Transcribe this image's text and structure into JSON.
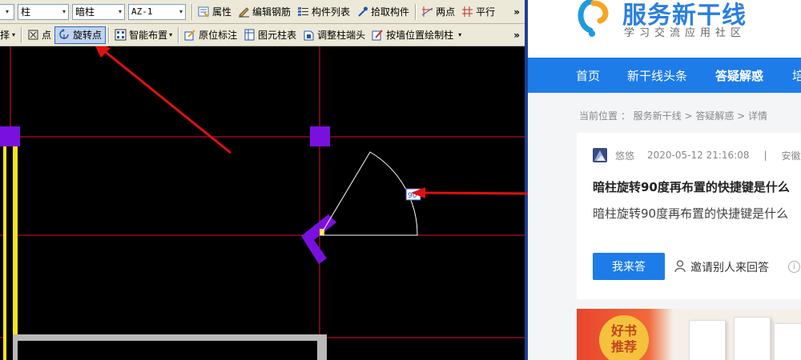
{
  "cad": {
    "toolbar1": {
      "combo_prefix_arrow": "▾",
      "combo_type": "柱",
      "combo_subtype": "暗柱",
      "combo_name": "AZ-1",
      "btn_properties": "属性",
      "btn_edit_rebar": "编辑钢筋",
      "btn_component_list": "构件列表",
      "btn_pick_component": "拾取构件",
      "btn_two_points": "两点",
      "btn_parallel": "平行",
      "more": "»"
    },
    "toolbar2": {
      "btn_select": "择",
      "btn_point": "点",
      "btn_rotate_point": "旋转点",
      "btn_smart_place": "智能布置",
      "btn_origin_mark": "原位标注",
      "btn_table_column": "图元柱表",
      "btn_adjust_column_end": "调整柱端头",
      "btn_place_by_wall": "按墙位置绘制柱",
      "more": "»"
    },
    "colors": {
      "background": "#000000",
      "grid_line": "#e0102a",
      "column_marker": "#7a10e0",
      "wall_yellow": "#f7e51c",
      "wall_gray": "#b9b9b9",
      "arrow": "#e01010"
    }
  },
  "web": {
    "site_name": "服务新干线",
    "site_slogan": "学习交流应用社区",
    "nav": [
      "首页",
      "新干线头条",
      "答疑解惑",
      "培"
    ],
    "breadcrumb": "当前位置 ： 服务新干线 > 答疑解惑 > 详情",
    "question": {
      "author": "悠悠",
      "date": "2020-05-12 21:16:08",
      "divider": "|",
      "region": "安徽省",
      "title": "暗柱旋转90度再布置的快捷键是什么",
      "description": "暗柱旋转90度再布置的快捷键是什么",
      "answer_button": "我来答",
      "invite_label": "邀请别人来回答",
      "info_glyph": "i"
    },
    "ad": {
      "badge_line1": "好书",
      "badge_line2": "推荐"
    },
    "colors": {
      "brand_blue": "#1d7ce8",
      "logo_orange": "#f5a623"
    }
  }
}
